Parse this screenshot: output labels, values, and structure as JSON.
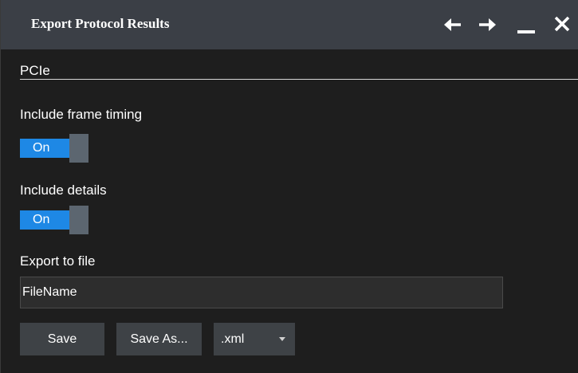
{
  "window": {
    "title": "Export Protocol Results",
    "controls": [
      "arrow-left-icon",
      "arrow-right-icon",
      "minimize-icon",
      "close-icon"
    ]
  },
  "section": {
    "title": "PCIe"
  },
  "frame_timing": {
    "label": "Include frame timing",
    "state": "On"
  },
  "details": {
    "label": "Include details",
    "state": "On"
  },
  "export": {
    "label": "Export to file",
    "file_name": "FileName"
  },
  "actions": {
    "save_label": "Save",
    "save_as_label": "Save As...",
    "format_value": ".xml"
  },
  "colors": {
    "title_bar": "#3b3f46",
    "background": "#1e1e1e",
    "toggle_on": "#1e88e5",
    "button": "#3e4246"
  }
}
